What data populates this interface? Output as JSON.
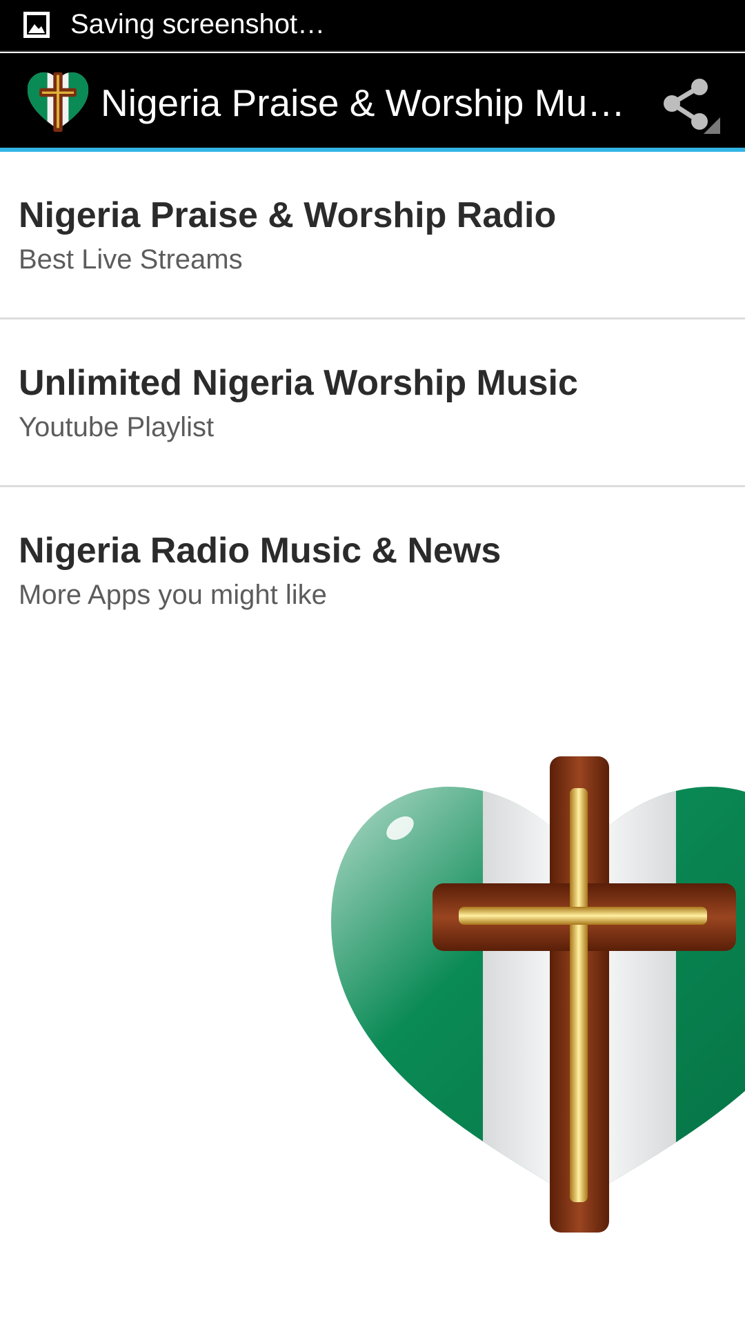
{
  "status_bar": {
    "icon": "image-icon",
    "text": "Saving screenshot…"
  },
  "action_bar": {
    "logo_icon": "heart-cross-logo-icon",
    "title": "Nigeria Praise & Worship Mu…",
    "share_icon": "share-icon",
    "accent_color": "#33b5e5"
  },
  "menu": {
    "items": [
      {
        "title": "Nigeria Praise & Worship Radio",
        "subtitle": "Best Live Streams"
      },
      {
        "title": "Unlimited Nigeria Worship Music",
        "subtitle": "Youtube Playlist"
      },
      {
        "title": "Nigeria Radio Music & News",
        "subtitle": "More Apps you might like"
      }
    ]
  },
  "hero": {
    "icon": "heart-cross-icon",
    "colors": {
      "green": "#0a8a55",
      "white": "#f2f2f2",
      "wood": "#7a2e10",
      "gold": "#e0b23a"
    }
  }
}
